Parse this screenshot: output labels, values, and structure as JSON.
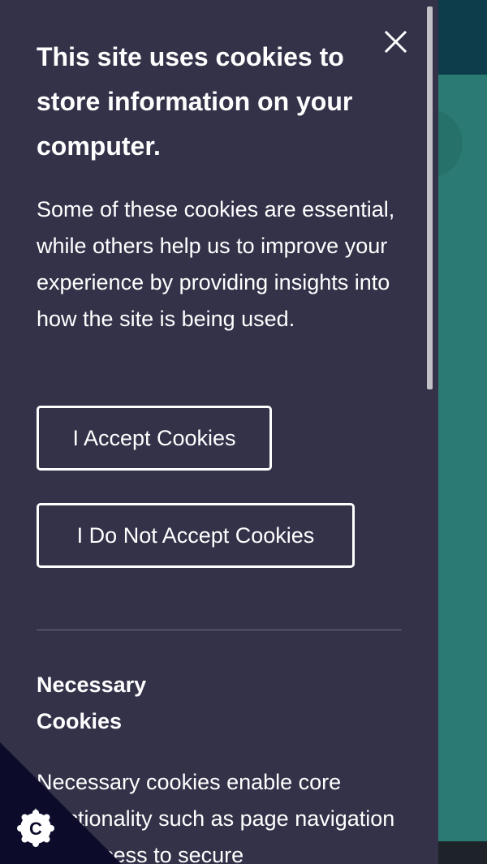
{
  "cookie_panel": {
    "title": "This site uses cookies to store information on your computer.",
    "intro": "Some of these cookies are essential, while others help us to improve your experience by providing insights into how the site is being used.",
    "accept_label": "I Accept Cookies",
    "reject_label": "I Do Not Accept Cookies",
    "close_icon": "close-icon",
    "sections": [
      {
        "title": "Necessary Cookies",
        "body": "Necessary cookies enable core functionality such as page navigation and access to secure"
      }
    ]
  },
  "corner_tab": {
    "icon": "cookie-settings-icon",
    "letter": "C"
  },
  "colors": {
    "panel_background": "#333249",
    "page_header": "#0d3d4b",
    "page_teal": "#2b7b74",
    "text": "#ffffff",
    "corner_tab": "#0c0b2a"
  }
}
